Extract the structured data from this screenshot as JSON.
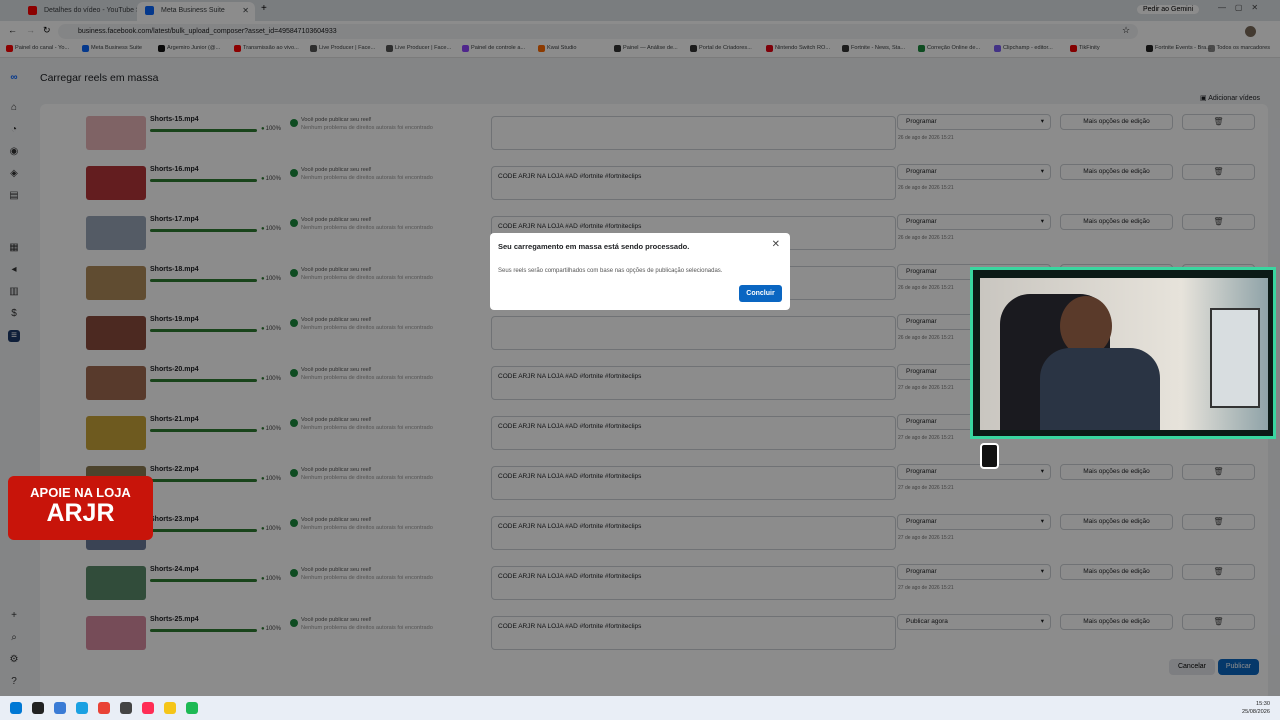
{
  "browser": {
    "tabs": [
      {
        "label": "Detalhes do vídeo - YouTube S"
      },
      {
        "label": "Meta Business Suite"
      }
    ],
    "url": "business.facebook.com/latest/bulk_upload_composer?asset_id=495847103604933",
    "gemini": "Pedir ao Gemini",
    "bookmarks": [
      "Painel do canal - Yo...",
      "Meta Business Suite",
      "Argemiro Junior (@...",
      "Transmissão ao vivo...",
      "Live Producer | Face...",
      "Live Producer | Face...",
      "Painel de controle a...",
      "Kwai Studio",
      "Painel — Análise de...",
      "Portal de Criadores...",
      "Nintendo Switch RO...",
      "Fortnite - News, Sta...",
      "Correção Online de...",
      "Clipchamp - editor...",
      "TikFinity",
      "Fortnite Events - Bra..."
    ],
    "all_bookmarks": "Todos os marcadores"
  },
  "page": {
    "title": "Carregar reels em massa",
    "add_videos": "Adicionar vídeos",
    "rows": [
      {
        "name": "Shorts-15.mp4",
        "pct": "100%",
        "ok": "Você pode publicar seu reel!",
        "sub": "Nenhum problema de direitos autorais foi encontrado",
        "caption": "",
        "option": "Programar",
        "date": "26 de ago de 2026 15:21",
        "color": "#e8b4b8"
      },
      {
        "name": "Shorts-16.mp4",
        "pct": "100%",
        "ok": "Você pode publicar seu reel!",
        "sub": "Nenhum problema de direitos autorais foi encontrado",
        "caption": "CODE ARJR NA LOJA #AD #fortnite #fortniteclips",
        "option": "Programar",
        "date": "26 de ago de 2026 15:21",
        "color": "#b5363a"
      },
      {
        "name": "Shorts-17.mp4",
        "pct": "100%",
        "ok": "Você pode publicar seu reel!",
        "sub": "Nenhum problema de direitos autorais foi encontrado",
        "caption": "CODE ARJR NA LOJA #AD #fortnite #fortniteclips",
        "option": "Programar",
        "date": "26 de ago de 2026 15:21",
        "color": "#9aa6b8"
      },
      {
        "name": "Shorts-18.mp4",
        "pct": "100%",
        "ok": "Você pode publicar seu reel!",
        "sub": "Nenhum problema de direitos autorais foi encontrado",
        "caption": "",
        "option": "Programar",
        "date": "26 de ago de 2026 15:21",
        "color": "#b08a5a"
      },
      {
        "name": "Shorts-19.mp4",
        "pct": "100%",
        "ok": "Você pode publicar seu reel!",
        "sub": "Nenhum problema de direitos autorais foi encontrado",
        "caption": "",
        "option": "Programar",
        "date": "26 de ago de 2026 15:21",
        "color": "#8a4b3c"
      },
      {
        "name": "Shorts-20.mp4",
        "pct": "100%",
        "ok": "Você pode publicar seu reel!",
        "sub": "Nenhum problema de direitos autorais foi encontrado",
        "caption": "CODE ARJR NA LOJA #AD #fortnite #fortniteclips",
        "option": "Programar",
        "date": "27 de ago de 2026 15:21",
        "color": "#a06a50"
      },
      {
        "name": "Shorts-21.mp4",
        "pct": "100%",
        "ok": "Você pode publicar seu reel!",
        "sub": "Nenhum problema de direitos autorais foi encontrado",
        "caption": "CODE ARJR NA LOJA #AD #fortnite #fortniteclips",
        "option": "Programar",
        "date": "27 de ago de 2026 15:21",
        "color": "#c9a43a"
      },
      {
        "name": "Shorts-22.mp4",
        "pct": "100%",
        "ok": "Você pode publicar seu reel!",
        "sub": "Nenhum problema de direitos autorais foi encontrado",
        "caption": "CODE ARJR NA LOJA #AD #fortnite #fortniteclips",
        "option": "Programar",
        "date": "27 de ago de 2026 15:21",
        "color": "#8a7a50"
      },
      {
        "name": "Shorts-23.mp4",
        "pct": "100%",
        "ok": "Você pode publicar seu reel!",
        "sub": "Nenhum problema de direitos autorais foi encontrado",
        "caption": "CODE ARJR NA LOJA #AD #fortnite #fortniteclips",
        "option": "Programar",
        "date": "27 de ago de 2026 15:21",
        "color": "#6a7a9a"
      },
      {
        "name": "Shorts-24.mp4",
        "pct": "100%",
        "ok": "Você pode publicar seu reel!",
        "sub": "Nenhum problema de direitos autorais foi encontrado",
        "caption": "CODE ARJR NA LOJA #AD #fortnite #fortniteclips",
        "option": "Programar",
        "date": "27 de ago de 2026 15:21",
        "color": "#5a8a6a"
      },
      {
        "name": "Shorts-25.mp4",
        "pct": "100%",
        "ok": "Você pode publicar seu reel!",
        "sub": "Nenhum problema de direitos autorais foi encontrado",
        "caption": "CODE ARJR NA LOJA #AD #fortnite #fortniteclips",
        "option": "Publicar agora",
        "date": "",
        "color": "#d88aa0"
      }
    ],
    "more_label": "Mais opções de edição",
    "cancel": "Cancelar",
    "publish": "Publicar"
  },
  "modal": {
    "title": "Seu carregamento em massa está sendo processado.",
    "body": "Seus reels serão compartilhados com base nas opções de publicação selecionadas.",
    "button": "Concluir"
  },
  "promo": {
    "line1": "APOIE NA LOJA",
    "line2": "ARJR"
  },
  "clock": {
    "time": "15:30",
    "date": "25/08/2026"
  }
}
